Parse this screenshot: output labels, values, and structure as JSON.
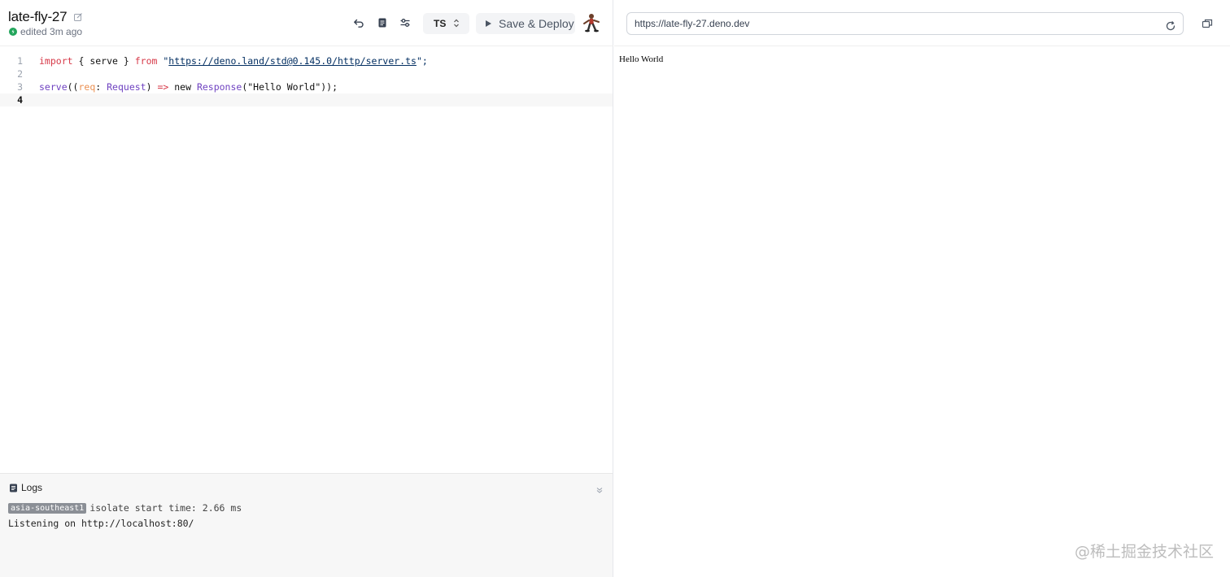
{
  "project": {
    "name": "late-fly-27",
    "status": "edited 3m ago"
  },
  "toolbar": {
    "language": "TS",
    "deploy_label": "Save & Deploy"
  },
  "editor": {
    "line_numbers": [
      "1",
      "2",
      "3",
      "4"
    ],
    "line1": {
      "kw_import": "import",
      "brace_open": " { ",
      "name": "serve",
      "brace_close": " } ",
      "kw_from": "from",
      "q_open": " \"",
      "url": "https://deno.land/std@0.145.0/http/server.ts",
      "q_close": "\";"
    },
    "line3": {
      "call": "serve",
      "paren": "((",
      "param": "req",
      "colon": ": ",
      "type": "Request",
      "arrow_pre": ") ",
      "arrow": "=>",
      "kw_new": " new ",
      "ctor": "Response",
      "arg": "(\"Hello World\"));"
    }
  },
  "logs": {
    "title": "Logs",
    "region": "asia-southeast1",
    "line1": "isolate start time: 2.66 ms",
    "line2": "Listening on http://localhost:80/"
  },
  "preview": {
    "url": "https://late-fly-27.deno.dev",
    "body": "Hello World"
  },
  "watermark": "@稀土掘金技术社区",
  "colors": {
    "status_green": "#22a55b",
    "keyword": "#d73a49",
    "function": "#6f42c1",
    "string": "#032f62"
  }
}
